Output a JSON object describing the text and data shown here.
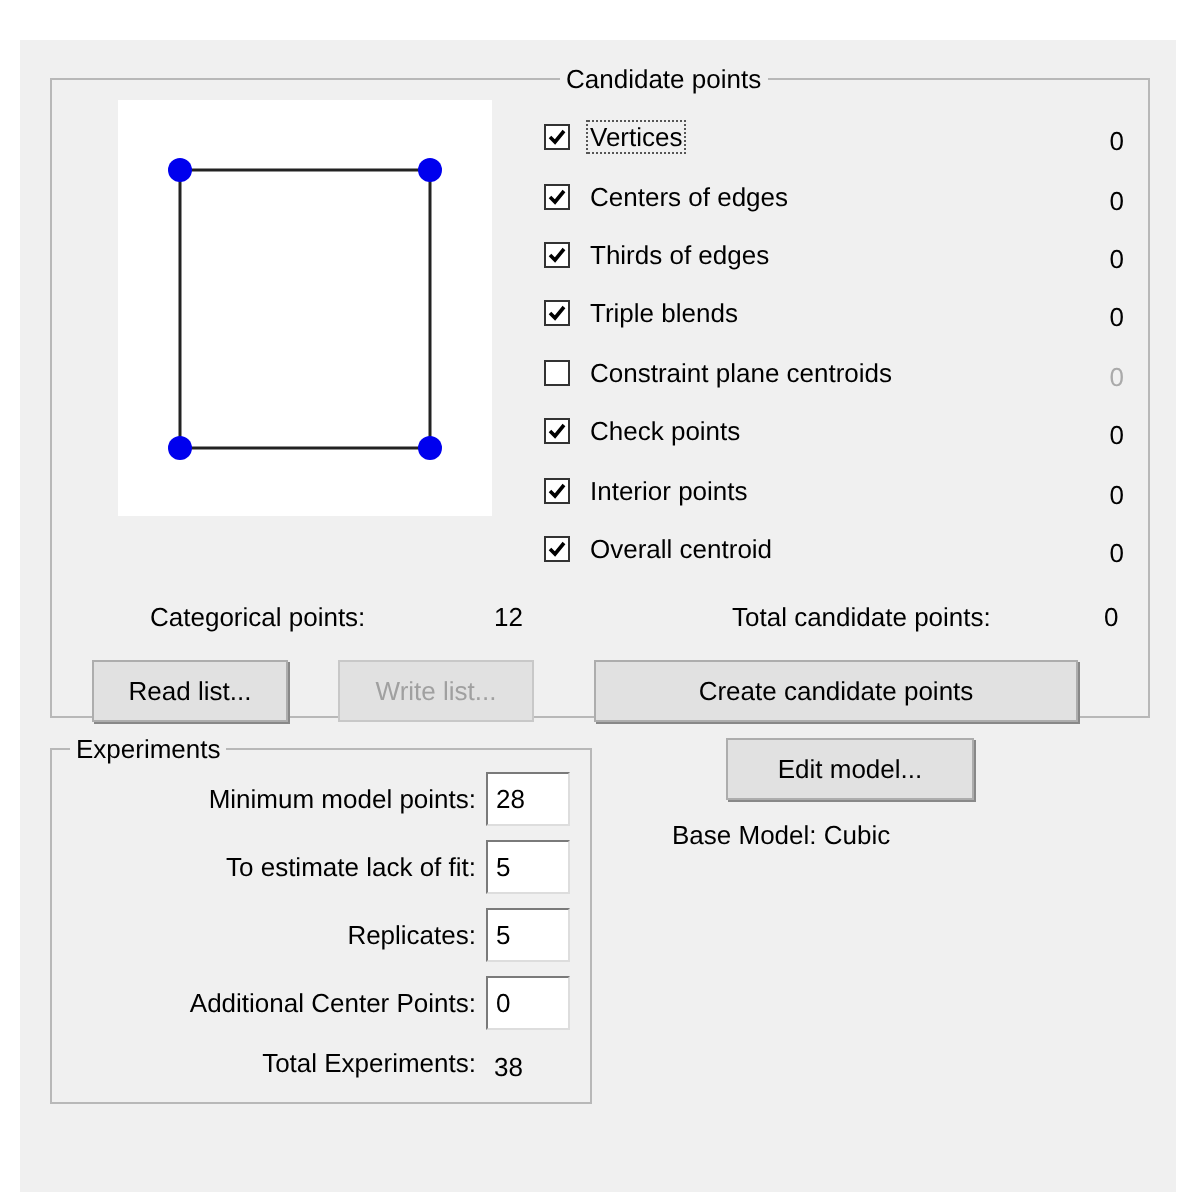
{
  "candidate_points": {
    "title": "Candidate points",
    "options": [
      {
        "label": "Vertices",
        "checked": true,
        "focused": true,
        "count": "0"
      },
      {
        "label": "Centers of edges",
        "checked": true,
        "focused": false,
        "count": "0"
      },
      {
        "label": "Thirds of edges",
        "checked": true,
        "focused": false,
        "count": "0"
      },
      {
        "label": "Triple blends",
        "checked": true,
        "focused": false,
        "count": "0"
      },
      {
        "label": "Constraint plane centroids",
        "checked": false,
        "focused": false,
        "count": "0"
      },
      {
        "label": "Check points",
        "checked": true,
        "focused": false,
        "count": "0"
      },
      {
        "label": "Interior points",
        "checked": true,
        "focused": false,
        "count": "0"
      },
      {
        "label": "Overall centroid",
        "checked": true,
        "focused": false,
        "count": "0"
      }
    ],
    "categorical_label": "Categorical points:",
    "categorical_value": "12",
    "total_label": "Total candidate points:",
    "total_value": "0",
    "buttons": [
      {
        "label": "Read list...",
        "disabled": false
      },
      {
        "label": "Write list...",
        "disabled": true
      },
      {
        "label": "Create candidate points",
        "disabled": false
      }
    ]
  },
  "experiments": {
    "title": "Experiments",
    "fields": [
      {
        "label": "Minimum model points:",
        "value": "28"
      },
      {
        "label": "To estimate lack of fit:",
        "value": "5"
      },
      {
        "label": "Replicates:",
        "value": "5"
      },
      {
        "label": "Additional Center Points:",
        "value": "0"
      }
    ],
    "total_label": "Total Experiments:",
    "total_value": "38"
  },
  "model": {
    "button": "Edit model...",
    "base_model": "Base Model: Cubic"
  }
}
